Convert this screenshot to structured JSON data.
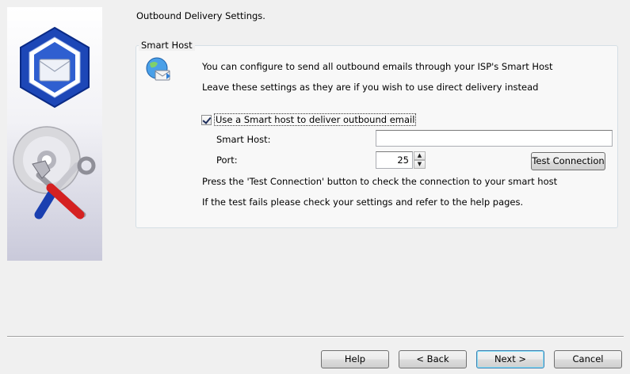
{
  "heading": "Outbound Delivery Settings.",
  "group": {
    "title": "Smart Host",
    "info_line1": "You can configure to send all outbound emails through your ISP's Smart Host",
    "info_line2": "Leave these settings as they are if you wish to use direct delivery instead",
    "checkbox_label": "Use a Smart host to deliver outbound email",
    "checkbox_checked": true,
    "smart_host_label": "Smart Host:",
    "smart_host_value": "",
    "port_label": "Port:",
    "port_value": "25",
    "test_button": "Test Connection",
    "help_line1": "Press the 'Test Connection' button to check the connection to your smart host",
    "help_line2": "If the test fails please check your settings and refer to the help pages."
  },
  "footer": {
    "help": "Help",
    "back": "< Back",
    "next": "Next >",
    "cancel": "Cancel"
  },
  "icons": {
    "side_panel": [
      "mail-hexagon-icon",
      "disc-tools-icon"
    ],
    "info": "globe-mail-icon",
    "spin": [
      "spin-up-icon",
      "spin-down-icon"
    ]
  }
}
